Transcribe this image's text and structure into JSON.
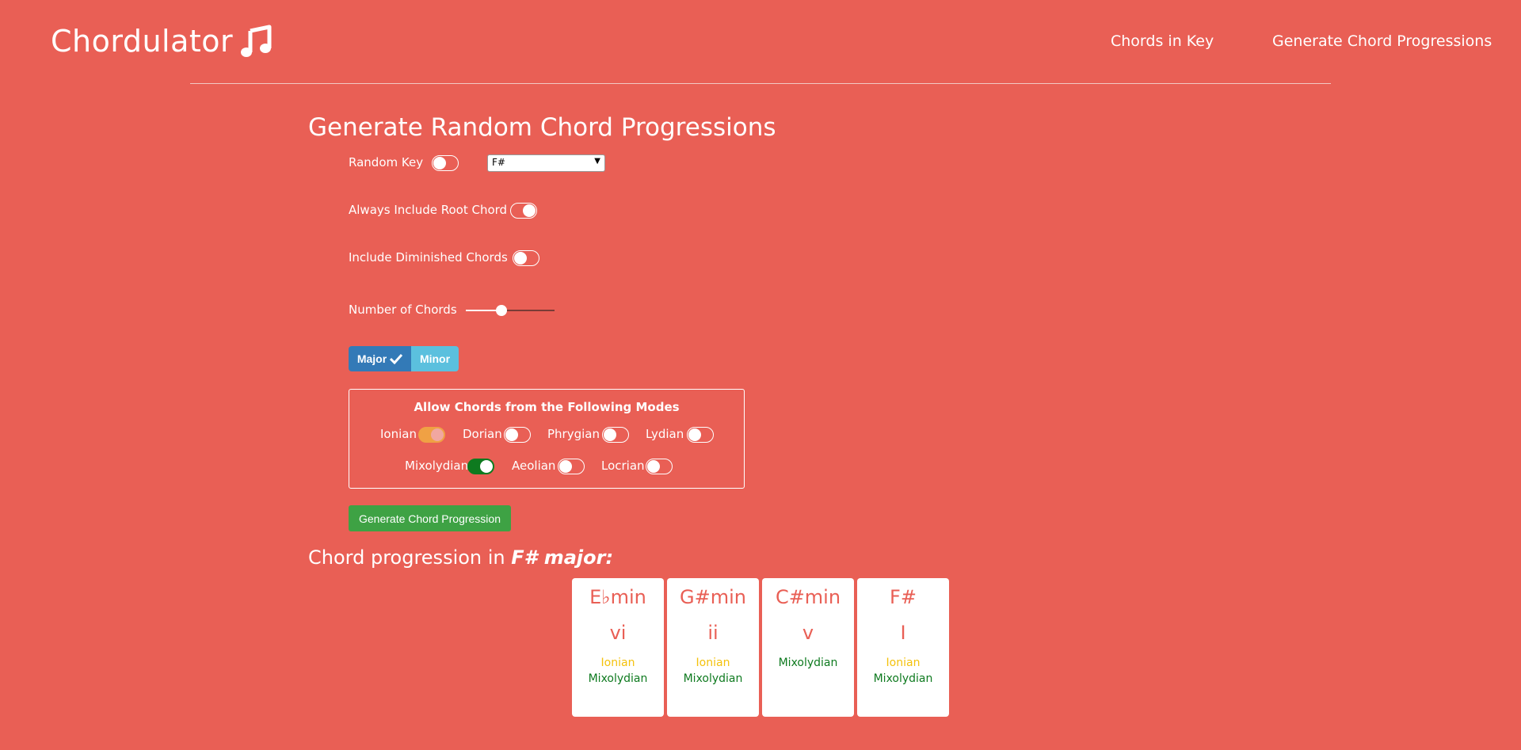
{
  "brand": {
    "name": "Chordulator",
    "icon": "music-note-icon"
  },
  "nav": {
    "chords_in_key": "Chords in Key",
    "generate_progressions": "Generate Chord Progressions"
  },
  "page_title": "Generate Random Chord Progressions",
  "options": {
    "random_key_label": "Random Key",
    "random_key_on": false,
    "key_value": "F#",
    "root_chord_label": "Always Include Root Chord",
    "root_chord_on": true,
    "diminished_label": "Include Diminished Chords",
    "diminished_on": false,
    "num_chords_label": "Number of Chords",
    "num_chords_fraction": 0.4
  },
  "scale_buttons": {
    "major": "Major",
    "minor": "Minor",
    "selected": "Major"
  },
  "modes": {
    "title": "Allow Chords from the Following Modes",
    "items": [
      {
        "label": "Ionian",
        "on": true,
        "color": "#f0a144"
      },
      {
        "label": "Dorian",
        "on": false
      },
      {
        "label": "Phrygian",
        "on": false
      },
      {
        "label": "Lydian",
        "on": false
      },
      {
        "label": "Mixolydian",
        "on": true,
        "color": "#0e7a1f"
      },
      {
        "label": "Aeolian",
        "on": false
      },
      {
        "label": "Locrian",
        "on": false
      }
    ]
  },
  "generate_button": "Generate Chord Progression",
  "result": {
    "prefix": "Chord progression in",
    "key": "F# major:",
    "chords": [
      {
        "name": "E♭min",
        "numeral": "vi",
        "mode1": "Ionian",
        "mode2": "Mixolydian"
      },
      {
        "name": "G#min",
        "numeral": "ii",
        "mode1": "Ionian",
        "mode2": "Mixolydian"
      },
      {
        "name": "C#min",
        "numeral": "v",
        "mode1": "Mixolydian",
        "mode2": ""
      },
      {
        "name": "F#",
        "numeral": "I",
        "mode1": "Ionian",
        "mode2": "Mixolydian"
      }
    ]
  },
  "colors": {
    "background": "#e95f55",
    "major_button": "#337ab7",
    "minor_button": "#5bc0de",
    "generate_button": "#3ea244",
    "ionian": "#f4c20d",
    "mixolydian": "#0e7a1f"
  }
}
